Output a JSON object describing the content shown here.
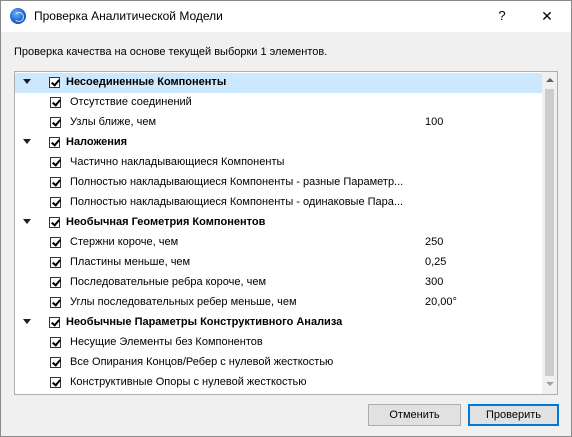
{
  "window": {
    "title": "Проверка Аналитической Модели",
    "help_label": "?",
    "close_label": "✕"
  },
  "header_text": "Проверка качества на основе текущей выборки 1 элементов.",
  "list": {
    "rows": [
      {
        "type": "group",
        "label": "Несоединенные Компоненты",
        "value": "",
        "selected": true
      },
      {
        "type": "item",
        "label": "Отсутствие соединений",
        "value": ""
      },
      {
        "type": "item",
        "label": "Узлы ближе, чем",
        "value": "100"
      },
      {
        "type": "group",
        "label": "Наложения",
        "value": ""
      },
      {
        "type": "item",
        "label": "Частично накладывающиеся Компоненты",
        "value": ""
      },
      {
        "type": "item",
        "label": "Полностью накладывающиеся Компоненты - разные Параметр...",
        "value": ""
      },
      {
        "type": "item",
        "label": "Полностью накладывающиеся Компоненты - одинаковые Пара...",
        "value": ""
      },
      {
        "type": "group",
        "label": "Необычная Геометрия Компонентов",
        "value": ""
      },
      {
        "type": "item",
        "label": "Стержни короче, чем",
        "value": "250"
      },
      {
        "type": "item",
        "label": "Пластины меньше, чем",
        "value": "0,25"
      },
      {
        "type": "item",
        "label": "Последовательные ребра короче, чем",
        "value": "300"
      },
      {
        "type": "item",
        "label": "Углы последовательных ребер меньше, чем",
        "value": "20,00°"
      },
      {
        "type": "group",
        "label": "Необычные Параметры Конструктивного Анализа",
        "value": ""
      },
      {
        "type": "item",
        "label": "Несущие Элементы без Компонентов",
        "value": ""
      },
      {
        "type": "item",
        "label": "Все Опирания Концов/Ребер с нулевой жесткостью",
        "value": ""
      },
      {
        "type": "item",
        "label": "Конструктивные Опоры с нулевой жесткостью",
        "value": ""
      }
    ]
  },
  "buttons": {
    "cancel_label": "Отменить",
    "ok_label": "Проверить"
  },
  "colors": {
    "selection": "#cce8ff",
    "default_button_border": "#0078d7"
  }
}
